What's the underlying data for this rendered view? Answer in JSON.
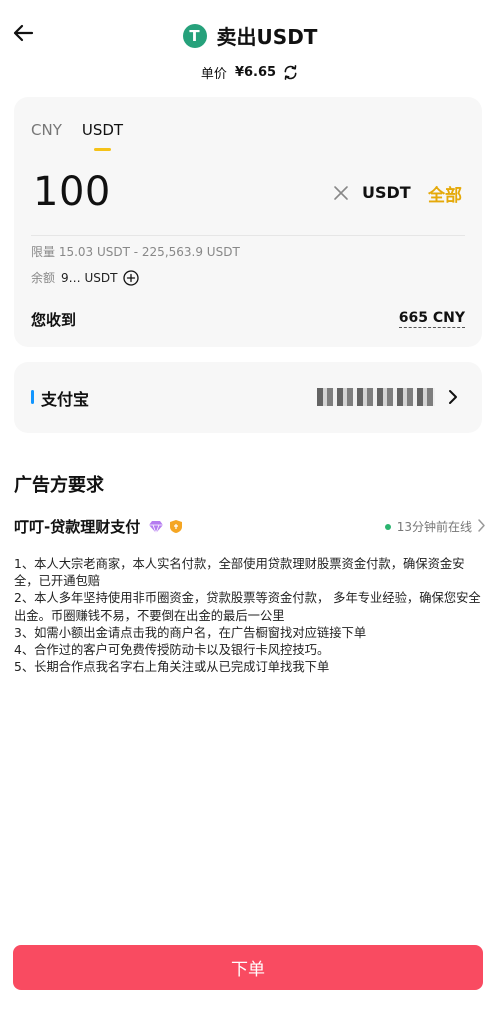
{
  "header": {
    "title": "卖出USDT",
    "logo_letter": "T"
  },
  "price": {
    "label": "单价",
    "value": "¥6.65"
  },
  "tabs": [
    {
      "label": "CNY",
      "active": false
    },
    {
      "label": "USDT",
      "active": true
    }
  ],
  "amount": {
    "value": "100",
    "unit": "USDT",
    "all_label": "全部"
  },
  "limit": "限量 15.03 USDT - 225,563.9 USDT",
  "balance": {
    "label": "余额",
    "value": "9… USDT"
  },
  "receive": {
    "label": "您收到",
    "value": "665 CNY"
  },
  "payment": {
    "method": "支付宝"
  },
  "advertiser": {
    "section_title": "广告方要求",
    "name": "叮叮-贷款理财支付",
    "status": "13分钟前在线",
    "terms": [
      "1、本人大宗老商家，本人实名付款，全部使用贷款理财股票资金付款，确保资金安全，已开通包赔",
      "2、本人多年坚持使用非币圈资金，贷款股票等资金付款， 多年专业经验，确保您安全出金。币圈赚钱不易，不要倒在出金的最后一公里",
      "3、如需小额出金请点击我的商户名，在广告橱窗找对应链接下单",
      "4、合作过的客户可免费传授防动卡以及银行卡风控技巧。",
      "5、长期合作点我名字右上角关注或从已完成订单找我下单"
    ]
  },
  "order_button": "下单",
  "colors": {
    "accent": "#f5c218",
    "all": "#e5a90a",
    "button": "#f94b61",
    "tether": "#26a17b",
    "alipay": "#1296ff",
    "online": "#2bb46f"
  }
}
